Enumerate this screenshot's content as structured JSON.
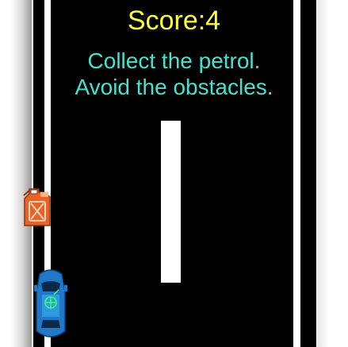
{
  "hud": {
    "score_label": "Score:4"
  },
  "instructions": {
    "line1": "Collect the petrol.",
    "line2": "Avoid the obstacles."
  },
  "sprites": {
    "petrol": "petrol-can-icon",
    "player": "player-car-icon"
  },
  "colors": {
    "road": "#000000",
    "lane": "#ffffff",
    "score_text": "#ffff33",
    "instruction_text": "#48e0cf",
    "petrol_can": "#e8632a",
    "car_body": "#1f78c8"
  }
}
